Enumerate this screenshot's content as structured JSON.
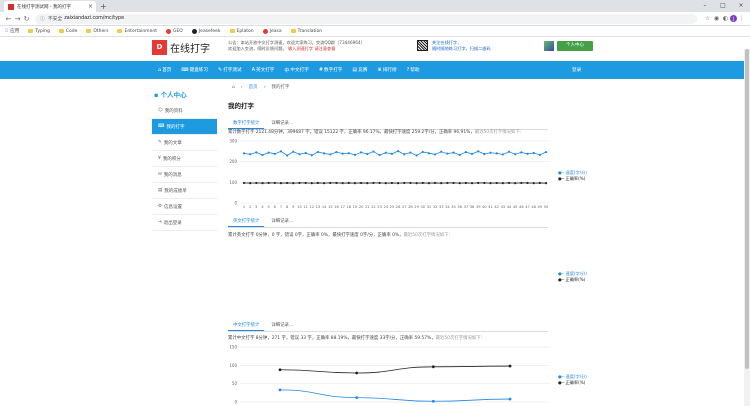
{
  "browser": {
    "tab_title": "在线打字测试网 - 我的打字",
    "url_prefix": "不安全",
    "url": "zaixiandazi.com/mc/type",
    "avatar_letter": "J",
    "bookmarks": [
      "应用",
      "Typing",
      "Code",
      "Others",
      "Entertainment",
      "GEO",
      "Jeasefeek",
      "Eplaton",
      "Jeasa",
      "Translation"
    ]
  },
  "site": {
    "logo_text": "D",
    "logo_name": "在线打字",
    "notice_line1": "公告：本站开放中文打字测速，欢迎大家练习。交流QQ群（73446964）",
    "notice_line2": "欢迎加入交流，随时反馈问题。",
    "notice_highlight": "输入测速打字",
    "notice_extra": "请注意查看",
    "qr_line1": "关注在线打字，",
    "qr_line2": "随时随地练习打字，扫描二维码",
    "user_button": "个人中心"
  },
  "nav": {
    "items": [
      {
        "icon": "⌂",
        "label": "首页"
      },
      {
        "icon": "⌨",
        "label": "键盘练习"
      },
      {
        "icon": "✎",
        "label": "打字测试"
      },
      {
        "icon": "A",
        "label": "英文打字"
      },
      {
        "icon": "中",
        "label": "中文打字"
      },
      {
        "icon": "#",
        "label": "数字打字"
      },
      {
        "icon": "▤",
        "label": "竞赛"
      },
      {
        "icon": "♛",
        "label": "排行榜"
      },
      {
        "icon": "?",
        "label": "帮助"
      }
    ],
    "right": "登录"
  },
  "breadcrumb": {
    "home": "首页",
    "sep": "›",
    "current": "我的打字"
  },
  "sidebar": {
    "title": "个人中心",
    "items": [
      {
        "icon": "☺",
        "label": "我的资料"
      },
      {
        "icon": "⌨",
        "label": "我的打字"
      },
      {
        "icon": "✎",
        "label": "我的文章"
      },
      {
        "icon": "¥",
        "label": "我的积分"
      },
      {
        "icon": "✉",
        "label": "我的消息"
      },
      {
        "icon": "▤",
        "label": "我的成绩单"
      },
      {
        "icon": "⚙",
        "label": "信息设置"
      },
      {
        "icon": "⇥",
        "label": "退出登录"
      }
    ]
  },
  "main": {
    "title": "我的打字",
    "sections": [
      {
        "tab_on": "数字打字统计",
        "tab_off": "详细记录...",
        "stats": "累计数字打字 2121.48分钟，399687 字，错误 15122 字，正确率 96.17%，最快打字速度 259.2字/分，正确率 96.91%，",
        "hint": "最近50次打字情况如下："
      },
      {
        "tab_on": "英文打字统计",
        "tab_off": "详细记录...",
        "stats": "累计英文打字 0分钟，0 字，错误 0字，正确率 0%，最快打字速度 0字/分，正确率 0%，",
        "hint": "最近50次打字情况如下："
      },
      {
        "tab_on": "中文打字统计",
        "tab_off": "详细记录...",
        "stats": "累计中文打字 8分钟，271 字，错误 33 字，正确率 88.19%，最快打字速度 33字/分，正确率 59.57%，",
        "hint": "最近50次打字情况如下："
      }
    ],
    "legend": {
      "speed": "速度(字/分)",
      "accuracy": "正确率(%)"
    }
  },
  "chart_data": [
    {
      "type": "line",
      "title": "",
      "ylim": [
        0,
        300
      ],
      "yticks": [
        0,
        100,
        200,
        300
      ],
      "x": [
        1,
        2,
        3,
        4,
        5,
        6,
        7,
        8,
        9,
        10,
        11,
        12,
        13,
        14,
        15,
        16,
        17,
        18,
        19,
        20,
        21,
        22,
        23,
        24,
        25,
        26,
        27,
        28,
        29,
        30,
        31,
        32,
        33,
        34,
        35,
        36,
        37,
        38,
        39,
        40,
        41,
        42,
        43,
        44,
        45,
        46,
        47,
        48,
        49,
        50
      ],
      "series": [
        {
          "name": "速度(字/分)",
          "color": "#1e88e5",
          "values": [
            240,
            236,
            245,
            232,
            244,
            238,
            250,
            230,
            248,
            236,
            242,
            231,
            247,
            240,
            235,
            246,
            239,
            241,
            233,
            245,
            237,
            249,
            232,
            243,
            238,
            251,
            236,
            244,
            230,
            247,
            241,
            235,
            248,
            239,
            244,
            233,
            246,
            238,
            250,
            237,
            243,
            240,
            235,
            248,
            236,
            245,
            238,
            242,
            233,
            246
          ]
        },
        {
          "name": "正确率(%)",
          "color": "#222222",
          "values": [
            97,
            96,
            97,
            96,
            97,
            97,
            96,
            97,
            96,
            97,
            97,
            96,
            97,
            96,
            97,
            97,
            96,
            97,
            96,
            97,
            96,
            97,
            97,
            96,
            97,
            96,
            97,
            97,
            96,
            97,
            96,
            97,
            96,
            97,
            97,
            96,
            97,
            96,
            97,
            97,
            96,
            97,
            96,
            97,
            96,
            97,
            97,
            96,
            97,
            96
          ]
        }
      ]
    },
    {
      "type": "line",
      "title": "",
      "x": [],
      "series": [
        {
          "name": "速度(字/分)",
          "values": []
        },
        {
          "name": "正确率(%)",
          "values": []
        }
      ]
    },
    {
      "type": "line",
      "title": "",
      "ylim": [
        0,
        150
      ],
      "yticks": [
        0,
        50,
        100,
        150
      ],
      "x": [
        1,
        2,
        3,
        4
      ],
      "series": [
        {
          "name": "速度(字/分)",
          "color": "#1e88e5",
          "values": [
            33,
            12,
            2,
            8
          ]
        },
        {
          "name": "正确率(%)",
          "color": "#222222",
          "values": [
            88,
            79,
            96,
            98
          ]
        }
      ]
    }
  ]
}
